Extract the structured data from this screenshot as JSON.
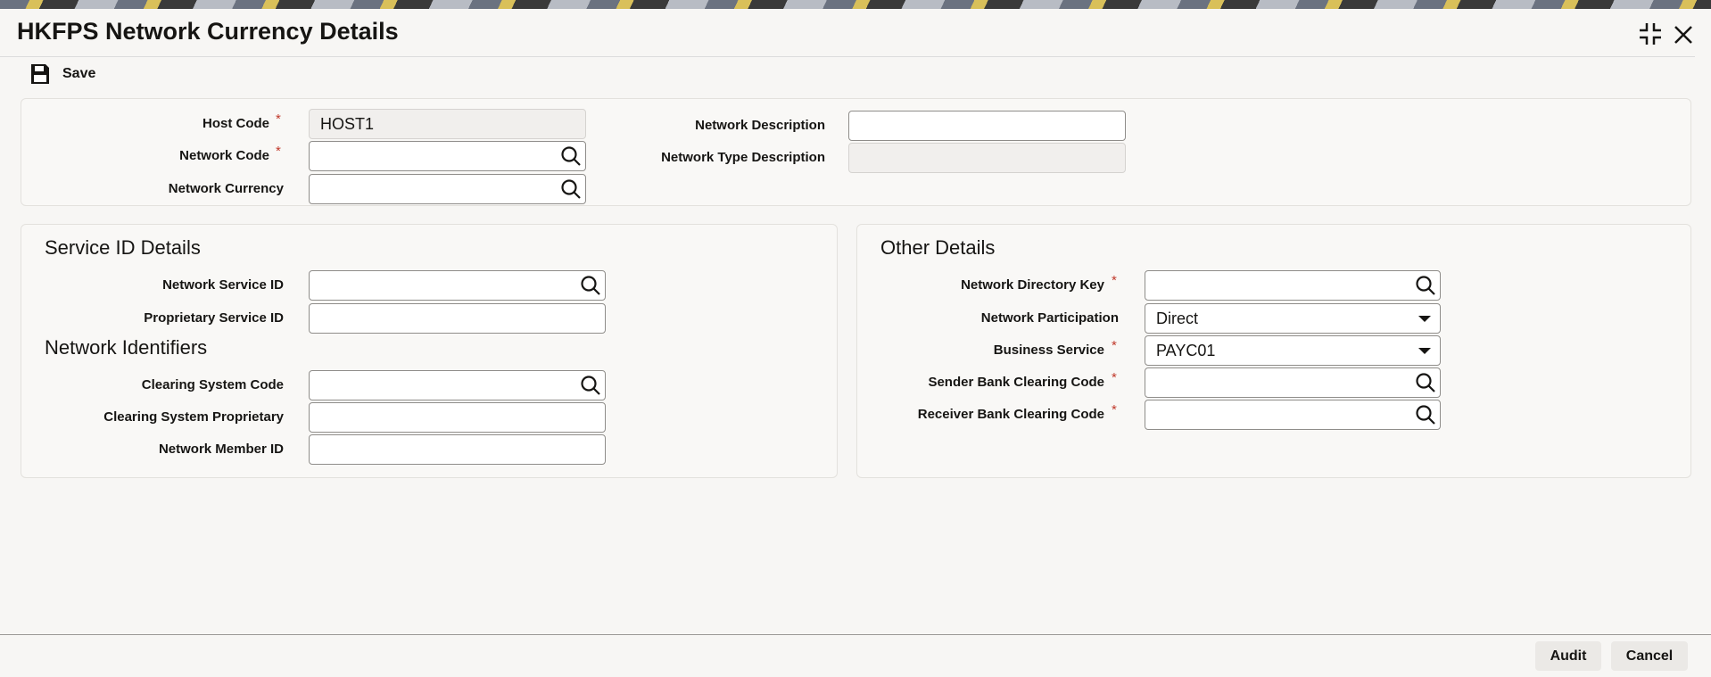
{
  "window": {
    "title": "HKFPS Network Currency Details",
    "restore_icon": "collapse-icon",
    "close_icon": "close-icon"
  },
  "toolbar": {
    "save_label": "Save"
  },
  "header_form": {
    "host_code": {
      "label": "Host Code",
      "value": "HOST1",
      "required": true
    },
    "network_code": {
      "label": "Network Code",
      "value": "",
      "required": true
    },
    "network_currency": {
      "label": "Network Currency",
      "value": ""
    },
    "network_description": {
      "label": "Network Description",
      "value": ""
    },
    "network_type_description": {
      "label": "Network Type Description",
      "value": ""
    }
  },
  "service_id_details": {
    "heading": "Service ID Details",
    "network_service_id": {
      "label": "Network Service ID",
      "value": ""
    },
    "proprietary_service_id": {
      "label": "Proprietary Service ID",
      "value": ""
    }
  },
  "network_identifiers": {
    "heading": "Network Identifiers",
    "clearing_system_code": {
      "label": "Clearing System Code",
      "value": ""
    },
    "clearing_system_proprietary": {
      "label": "Clearing System Proprietary",
      "value": ""
    },
    "network_member_id": {
      "label": "Network Member ID",
      "value": ""
    }
  },
  "other_details": {
    "heading": "Other Details",
    "network_directory_key": {
      "label": "Network Directory Key",
      "value": "",
      "required": true
    },
    "network_participation": {
      "label": "Network Participation",
      "value": "Direct"
    },
    "business_service": {
      "label": "Business Service",
      "value": "PAYC01",
      "required": true
    },
    "sender_bank_clearing_code": {
      "label": "Sender Bank Clearing Code",
      "value": "",
      "required": true
    },
    "receiver_bank_clearing_code": {
      "label": "Receiver Bank Clearing Code",
      "value": "",
      "required": true
    }
  },
  "footer": {
    "audit_label": "Audit",
    "cancel_label": "Cancel"
  },
  "required_mark": "*"
}
